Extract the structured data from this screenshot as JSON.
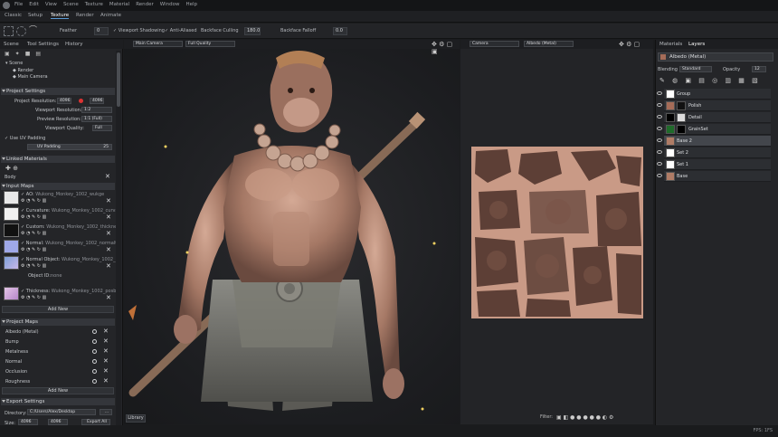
{
  "menubar": {
    "items": [
      "File",
      "Edit",
      "View",
      "Scene",
      "Texture",
      "Material",
      "Render",
      "Window",
      "Help"
    ]
  },
  "modetabs": [
    "Classic",
    "Setup",
    "Texture",
    "Render",
    "Animate"
  ],
  "toolbar": {
    "feather_label": "Feather",
    "feather_value": "0",
    "viewport_shadowing": "Viewport Shadowing",
    "anti_aliased": "Anti-Aliased",
    "backface_culling": "Backface Culling",
    "backface_culling_value": "180.0",
    "backface_falloff": "Backface Falloff",
    "backface_falloff_value": "0.0"
  },
  "left_panel": {
    "tabs": [
      "Scene",
      "Tool Settings",
      "History"
    ],
    "tree": [
      "Scene",
      "Render",
      "Main Camera"
    ],
    "project_settings": {
      "title": "Project Settings",
      "project_resolution_label": "Project Resolution:",
      "project_resolution_w": "4096",
      "project_resolution_h": "4096",
      "viewport_resolution_label": "Viewport Resolution:",
      "viewport_resolution_value": "1:2",
      "preview_resolution_label": "Preview Resolution:",
      "preview_resolution_value": "1:1 (Full)",
      "viewport_quality_label": "Viewport Quality:",
      "viewport_quality_value": "Full",
      "use_uv_padding": "Use UV Padding",
      "uv_padding_label": "UV Padding",
      "uv_padding_value": "25"
    },
    "linked_materials": {
      "title": "Linked Materials",
      "body": "Body"
    },
    "input_maps": {
      "title": "Input Maps",
      "items": [
        {
          "label": "AO:",
          "file": "Wukong_Monkey_1002_wukge"
        },
        {
          "label": "Curvature:",
          "file": "Wukong_Monkey_1002_curva"
        },
        {
          "label": "Custom:",
          "file": "Wukong_Monkey_1002_thicknes"
        },
        {
          "label": "Normal:",
          "file": "Wukong_Monkey_1002_normalt"
        },
        {
          "label": "Normal Object:",
          "file": "Wukong_Monkey_1002_n"
        },
        {
          "label": "Thickness:",
          "file": "Wukong_Monkey_1002_posbs"
        }
      ],
      "object_id_label": "Object ID:",
      "object_id_value": "none",
      "add_new": "Add New"
    },
    "project_maps": {
      "title": "Project Maps",
      "items": [
        "Albedo (Metal)",
        "Bump",
        "Metalness",
        "Normal",
        "Occlusion",
        "Roughness"
      ],
      "add_new": "Add New"
    },
    "export_settings": {
      "title": "Export Settings",
      "directory_label": "Directory:",
      "directory_value": "C:/Users/Alex/Desktop",
      "size_label": "Size:",
      "size_value": "4096",
      "size_value2": "4096",
      "export_all": "Export All"
    }
  },
  "viewport": {
    "camera": "Main Camera",
    "quality": "Full Quality",
    "library_tab": "Library"
  },
  "uv_view": {
    "camera": "Camera",
    "channel": "Albedo (Metal)",
    "filter_label": "Filter:"
  },
  "right_panel": {
    "tabs": [
      "Materials",
      "Layers"
    ],
    "material": "Albedo (Metal)",
    "blending_label": "Blending",
    "blending_value": "Standard",
    "opacity_label": "Opacity",
    "opacity_value": "12",
    "layers": [
      "Group",
      "Polish",
      "Detail",
      "GrainSet",
      "Base 2",
      "Set 2",
      "Set 1",
      "Base"
    ]
  },
  "status": {
    "fps": "FPS: 1FS"
  },
  "colors": {
    "accent": "#5b9bd5",
    "skin": "#b98b72",
    "uv_bg": "#c99a86"
  }
}
